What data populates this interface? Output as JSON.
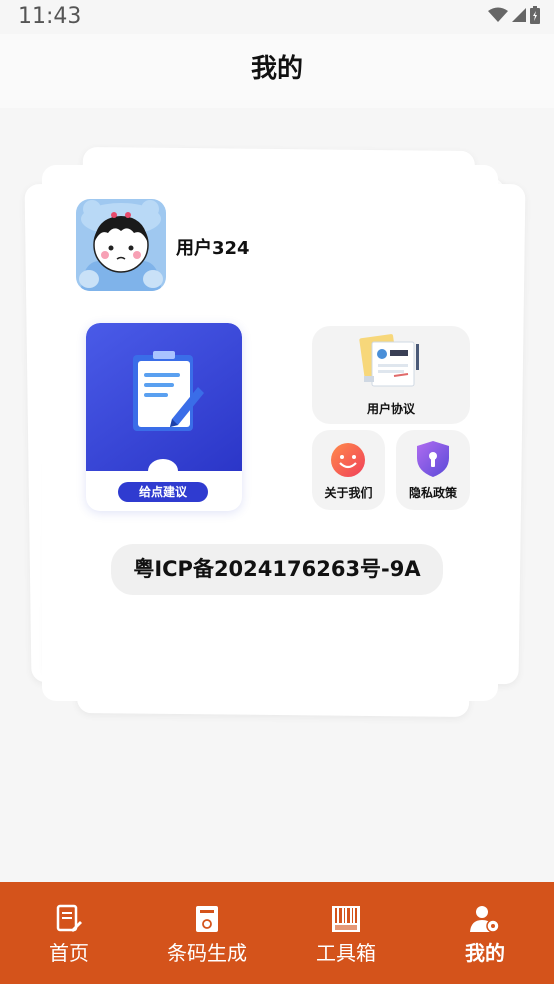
{
  "status_bar": {
    "time": "11:43"
  },
  "header": {
    "title": "我的"
  },
  "profile": {
    "username": "用户324"
  },
  "feedback": {
    "button_label": "给点建议"
  },
  "tiles": {
    "user_agreement": "用户协议",
    "about_us": "关于我们",
    "privacy_policy": "隐私政策"
  },
  "icp": {
    "text": "粤ICP备2024176263号-9A"
  },
  "bottom_nav": {
    "active": "mine",
    "items": [
      {
        "label": "首页",
        "icon": "home-doc-icon"
      },
      {
        "label": "条码生成",
        "icon": "barcode-generate-icon"
      },
      {
        "label": "工具箱",
        "icon": "toolbox-barcode-icon"
      },
      {
        "label": "我的",
        "icon": "user-settings-icon"
      }
    ]
  },
  "colors": {
    "nav_bg": "#d4531b",
    "feedback_blue": "#3442d8",
    "page_bg": "#f6f6f6"
  }
}
